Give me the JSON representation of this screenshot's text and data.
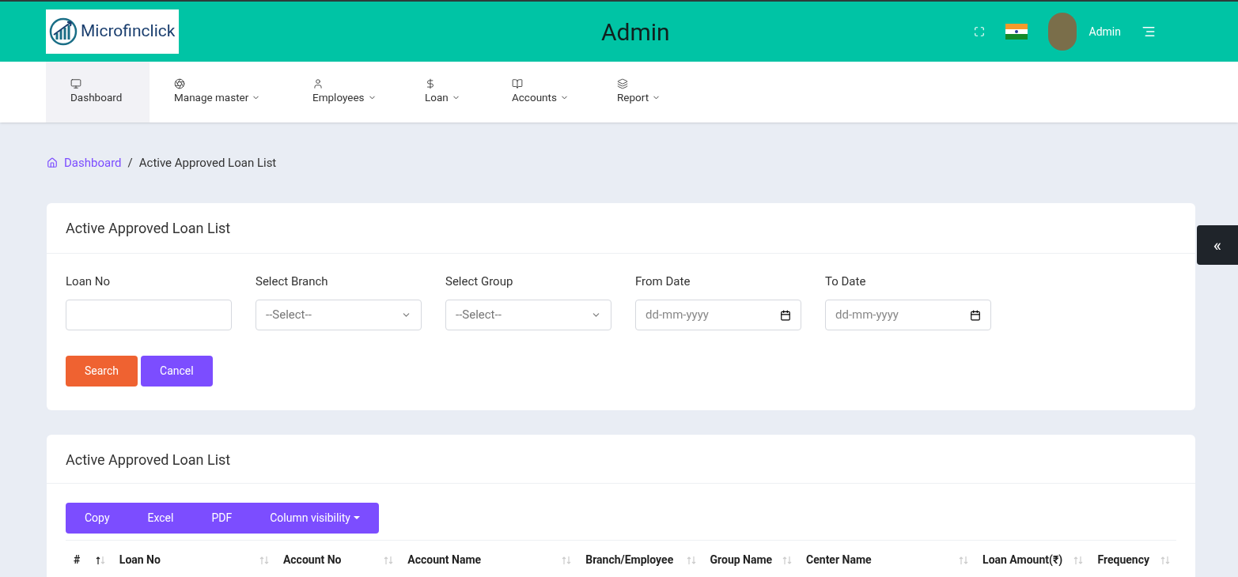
{
  "header": {
    "logo_text": "Microfinclick",
    "title": "Admin",
    "user_name": "Admin"
  },
  "nav": [
    {
      "label": "Dashboard",
      "dropdown": false,
      "selected": true
    },
    {
      "label": "Manage master",
      "dropdown": true,
      "selected": false
    },
    {
      "label": "Employees",
      "dropdown": true,
      "selected": false
    },
    {
      "label": "Loan",
      "dropdown": true,
      "selected": false
    },
    {
      "label": "Accounts",
      "dropdown": true,
      "selected": false
    },
    {
      "label": "Report",
      "dropdown": true,
      "selected": false
    }
  ],
  "breadcrumb": {
    "home": "Dashboard",
    "separator": "/",
    "current": "Active Approved Loan List"
  },
  "filter_card": {
    "title": "Active Approved Loan List",
    "fields": [
      {
        "label": "Loan No",
        "kind": "text"
      },
      {
        "label": "Select Branch",
        "kind": "select",
        "value": "--Select--"
      },
      {
        "label": "Select Group",
        "kind": "select",
        "value": "--Select--"
      },
      {
        "label": "From Date",
        "kind": "date",
        "placeholder": "dd-mm-yyyy"
      },
      {
        "label": "To Date",
        "kind": "date",
        "placeholder": "dd-mm-yyyy"
      }
    ],
    "buttons": [
      {
        "label": "Search",
        "kind": "primary"
      },
      {
        "label": "Cancel",
        "kind": "secondary"
      }
    ]
  },
  "table_card": {
    "title": "Active Approved Loan List",
    "export_buttons": [
      {
        "label": "Copy",
        "dropdown": false
      },
      {
        "label": "Excel",
        "dropdown": false
      },
      {
        "label": "PDF",
        "dropdown": false
      },
      {
        "label": "Column visibility",
        "dropdown": true
      }
    ],
    "columns": [
      {
        "label": "#",
        "sorted": true
      },
      {
        "label": "Loan No",
        "sorted": false
      },
      {
        "label": "Account No",
        "sorted": false
      },
      {
        "label": "Account Name",
        "sorted": false
      },
      {
        "label": "Branch/Employee",
        "sorted": false
      },
      {
        "label": "Group Name",
        "sorted": false
      },
      {
        "label": "Center Name",
        "sorted": false
      },
      {
        "label": "Loan Amount(₹)",
        "sorted": false
      },
      {
        "label": "Frequency",
        "sorted": false
      }
    ]
  },
  "side_toggle": "«"
}
